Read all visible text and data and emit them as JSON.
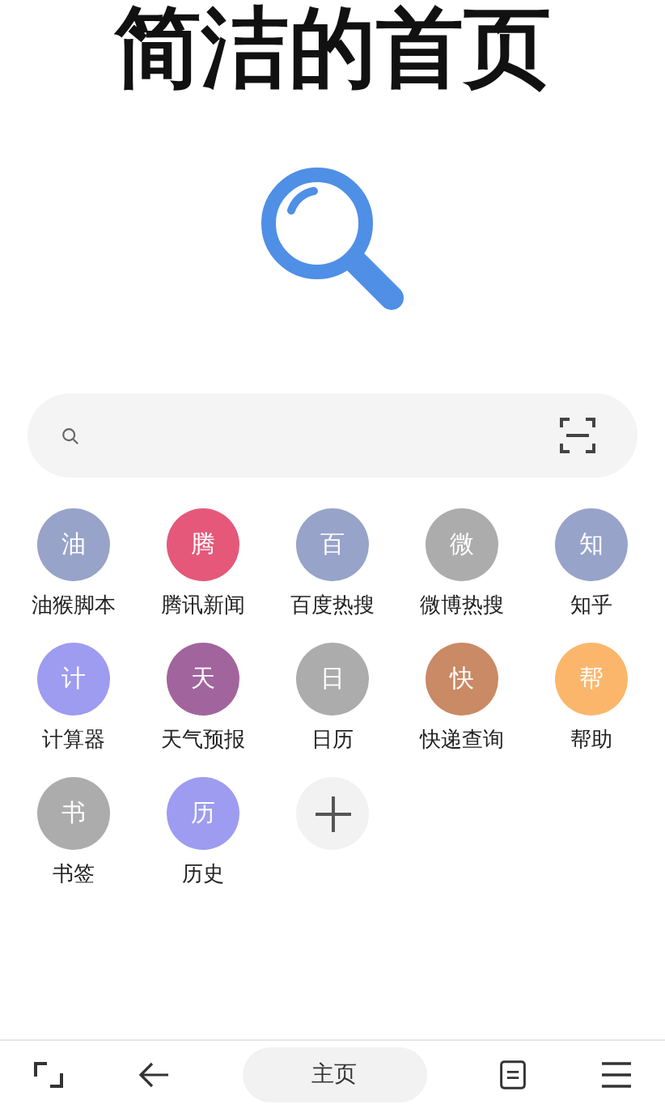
{
  "title": "简洁的首页",
  "shortcuts": [
    {
      "kind": "site",
      "glyph": "油",
      "label": "油猴脚本",
      "color": "#97a3c8"
    },
    {
      "kind": "site",
      "glyph": "腾",
      "label": "腾讯新闻",
      "color": "#e5587a"
    },
    {
      "kind": "site",
      "glyph": "百",
      "label": "百度热搜",
      "color": "#97a3c8"
    },
    {
      "kind": "site",
      "glyph": "微",
      "label": "微博热搜",
      "color": "#acacac"
    },
    {
      "kind": "site",
      "glyph": "知",
      "label": "知乎",
      "color": "#97a3c8"
    },
    {
      "kind": "site",
      "glyph": "计",
      "label": "计算器",
      "color": "#9d9cf0"
    },
    {
      "kind": "site",
      "glyph": "天",
      "label": "天气预报",
      "color": "#a2649d"
    },
    {
      "kind": "site",
      "glyph": "日",
      "label": "日历",
      "color": "#acacac"
    },
    {
      "kind": "site",
      "glyph": "快",
      "label": "快递查询",
      "color": "#c98a65"
    },
    {
      "kind": "site",
      "glyph": "帮",
      "label": "帮助",
      "color": "#fbb66c"
    },
    {
      "kind": "site",
      "glyph": "书",
      "label": "书签",
      "color": "#acacac"
    },
    {
      "kind": "site",
      "glyph": "历",
      "label": "历史",
      "color": "#9d9cf0"
    },
    {
      "kind": "add"
    }
  ],
  "bottom_bar": {
    "home_label": "主页"
  }
}
